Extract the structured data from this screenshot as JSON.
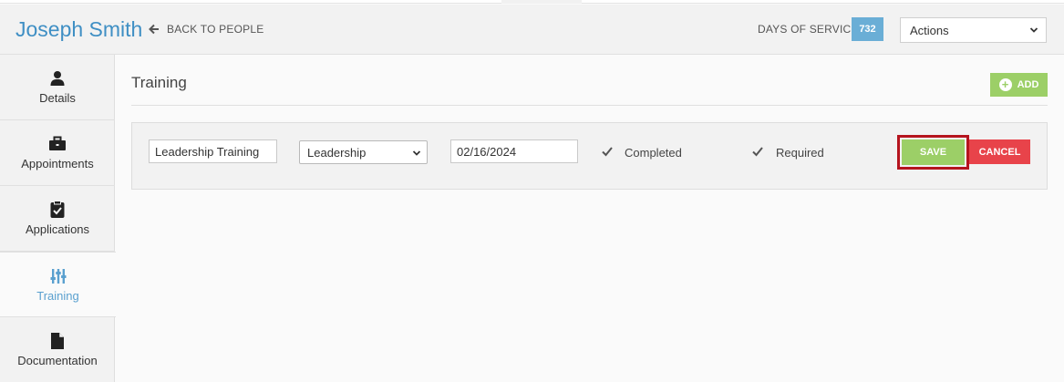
{
  "header": {
    "person_name": "Joseph Smith",
    "back_label": "BACK TO PEOPLE",
    "days_of_service_label": "DAYS OF SERVICE",
    "days_of_service_value": "732",
    "actions_label": "Actions"
  },
  "sidebar": {
    "items": [
      {
        "label": "Details",
        "icon": "user-icon"
      },
      {
        "label": "Appointments",
        "icon": "briefcase-icon"
      },
      {
        "label": "Applications",
        "icon": "clipboard-check-icon"
      },
      {
        "label": "Training",
        "icon": "sliders-icon",
        "active": true
      },
      {
        "label": "Documentation",
        "icon": "document-icon"
      }
    ]
  },
  "main": {
    "section_title": "Training",
    "add_label": "ADD",
    "row": {
      "name_value": "Leadership Training",
      "category_value": "Leadership",
      "date_value": "02/16/2024",
      "completed_label": "Completed",
      "completed_checked": true,
      "required_label": "Required",
      "required_checked": true,
      "save_label": "SAVE",
      "cancel_label": "CANCEL"
    }
  },
  "colors": {
    "accent": "#3f8fc4",
    "badge": "#6aaed6",
    "save": "#9ccf67",
    "cancel": "#e8434a",
    "highlight": "#b5141e"
  }
}
